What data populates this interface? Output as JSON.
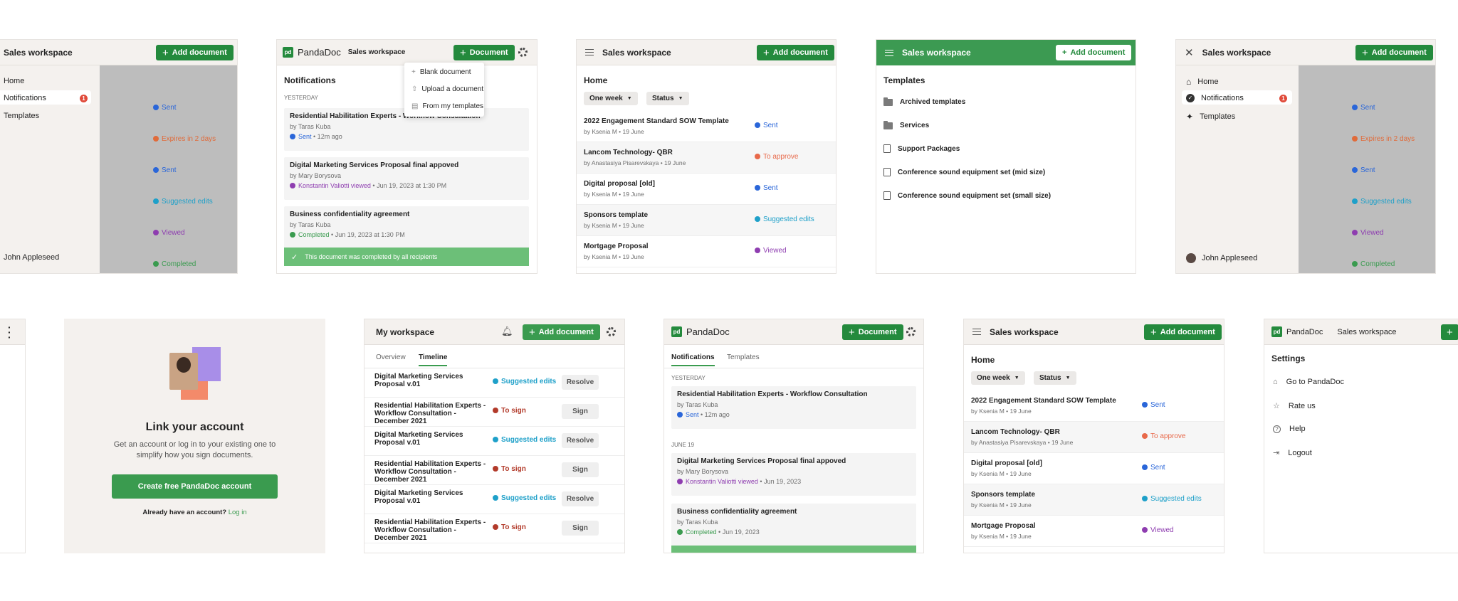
{
  "panel1": {
    "title": "Sales workspace",
    "add_label": "Add document",
    "nav": [
      "Home",
      "Notifications",
      "Templates"
    ],
    "badge": "1",
    "user": "John Appleseed",
    "statuses": [
      "Sent",
      "Expires in 2 days",
      "Sent",
      "Suggested edits",
      "Viewed",
      "Completed"
    ]
  },
  "panel2": {
    "brand": "PandaDoc",
    "workspace": "Sales workspace",
    "document_label": "Document",
    "menu": [
      "Blank document",
      "Upload a document",
      "From my templates"
    ],
    "heading": "Notifications",
    "group": "YESTERDAY",
    "cards": [
      {
        "title": "Residential Habilitation Experts - Workflow Consultation",
        "by": "by Taras Kuba",
        "status": "Sent",
        "meta": "• 12m ago"
      },
      {
        "title": "Digital Marketing Services Proposal final appoved",
        "by": "by Mary Borysova",
        "status": "Konstantin Valiotti viewed",
        "meta": "• Jun 19, 2023 at 1:30 PM"
      },
      {
        "title": "Business confidentiality agreement",
        "by": "by Taras Kuba",
        "status": "Completed",
        "meta": "• Jun 19, 2023 at 1:30 PM"
      }
    ],
    "toast": "This document was completed by all recipients"
  },
  "panel3": {
    "title": "Sales workspace",
    "add_label": "Add document",
    "home": "Home",
    "filter1": "One week",
    "filter2": "Status",
    "rows": [
      {
        "title": "2022 Engagement Standard SOW Template",
        "by": "by Ksenia M • 19 June",
        "status": "Sent"
      },
      {
        "title": "Lancom Technology- QBR",
        "by": "by Anastasiya Pisarevskaya • 19 June",
        "status": "To approve"
      },
      {
        "title": "Digital proposal [old]",
        "by": "by Ksenia M • 19 June",
        "status": "Sent"
      },
      {
        "title": "Sponsors template",
        "by": "by Ksenia M • 19 June",
        "status": "Suggested edits"
      },
      {
        "title": "Mortgage Proposal",
        "by": "by Ksenia M • 19 June",
        "status": "Viewed"
      }
    ]
  },
  "panel4": {
    "title": "Sales workspace",
    "add_label": "Add document",
    "heading": "Templates",
    "items": [
      {
        "label": "Archived templates",
        "icon": "folder-icon"
      },
      {
        "label": "Services",
        "icon": "folder-icon"
      },
      {
        "label": "Support Packages",
        "icon": "document-icon"
      },
      {
        "label": "Conference sound equipment set (mid size)",
        "icon": "document-icon"
      },
      {
        "label": "Conference sound equipment set (small size)",
        "icon": "document-icon"
      }
    ]
  },
  "panel5": {
    "title": "Sales workspace",
    "add_label": "Add document",
    "nav": [
      "Home",
      "Notifications",
      "Templates"
    ],
    "badge": "1",
    "user": "John Appleseed",
    "statuses": [
      "Sent",
      "Expires in 2 days",
      "Sent",
      "Suggested edits",
      "Viewed",
      "Completed"
    ]
  },
  "panel7": {
    "heading": "Link your account",
    "body": "Get an account or log in to your existing one to simplify how you sign documents.",
    "cta": "Create free PandaDoc account",
    "have_account": "Already have an account?",
    "login": "Log in"
  },
  "panel8": {
    "title": "My workspace",
    "add_label": "Add document",
    "tabs": [
      "Overview",
      "Timeline"
    ],
    "rows": [
      {
        "title": "Digital Marketing Services Proposal v.01",
        "status": "Suggested edits",
        "action": "Resolve"
      },
      {
        "title": "Residential Habilitation Experts - Workflow Consultation - December 2021",
        "status": "To sign",
        "action": "Sign"
      },
      {
        "title": "Digital Marketing Services Proposal v.01",
        "status": "Suggested edits",
        "action": "Resolve"
      },
      {
        "title": "Residential Habilitation Experts - Workflow Consultation - December 2021",
        "status": "To sign",
        "action": "Sign"
      },
      {
        "title": "Digital Marketing Services Proposal v.01",
        "status": "Suggested edits",
        "action": "Resolve"
      },
      {
        "title": "Residential Habilitation Experts - Workflow Consultation - December 2021",
        "status": "To sign",
        "action": "Sign"
      }
    ]
  },
  "panel9": {
    "brand": "PandaDoc",
    "document_label": "Document",
    "tabs": [
      "Notifications",
      "Templates"
    ],
    "group1": "YESTERDAY",
    "group2": "JUNE 19",
    "cards": [
      {
        "title": "Residential Habilitation Experts - Workflow Consultation",
        "by": "by Taras Kuba",
        "status": "Sent",
        "meta": "• 12m ago"
      },
      {
        "title": "Digital Marketing Services Proposal final appoved",
        "by": "by Mary Borysova",
        "status": "Konstantin Valiotti viewed",
        "meta": "• Jun 19, 2023"
      },
      {
        "title": "Business confidentiality agreement",
        "by": "by Taras Kuba",
        "status": "Completed",
        "meta": "• Jun 19, 2023"
      }
    ]
  },
  "panel10": {
    "title": "Sales workspace",
    "add_label": "Add document",
    "home": "Home",
    "filter1": "One week",
    "filter2": "Status",
    "rows": [
      {
        "title": "2022 Engagement Standard SOW Template",
        "by": "by Ksenia M • 19 June",
        "status": "Sent"
      },
      {
        "title": "Lancom Technology- QBR",
        "by": "by Anastasiya Pisarevskaya • 19 June",
        "status": "To approve"
      },
      {
        "title": "Digital proposal [old]",
        "by": "by Ksenia M • 19 June",
        "status": "Sent"
      },
      {
        "title": "Sponsors template",
        "by": "by Ksenia M • 19 June",
        "status": "Suggested edits"
      },
      {
        "title": "Mortgage Proposal",
        "by": "by Ksenia M • 19 June",
        "status": "Viewed"
      }
    ]
  },
  "panel11": {
    "brand": "PandaDoc",
    "workspace": "Sales workspace",
    "heading": "Settings",
    "items": [
      {
        "label": "Go to PandaDoc",
        "icon": "home-icon"
      },
      {
        "label": "Rate us",
        "icon": "star-icon"
      },
      {
        "label": "Help",
        "icon": "help-icon"
      },
      {
        "label": "Logout",
        "icon": "logout-icon"
      }
    ]
  },
  "colors": {
    "brand_green": "#248a3d",
    "header_bg": "#f4f1ee",
    "overlay": "#bdbdbd"
  }
}
